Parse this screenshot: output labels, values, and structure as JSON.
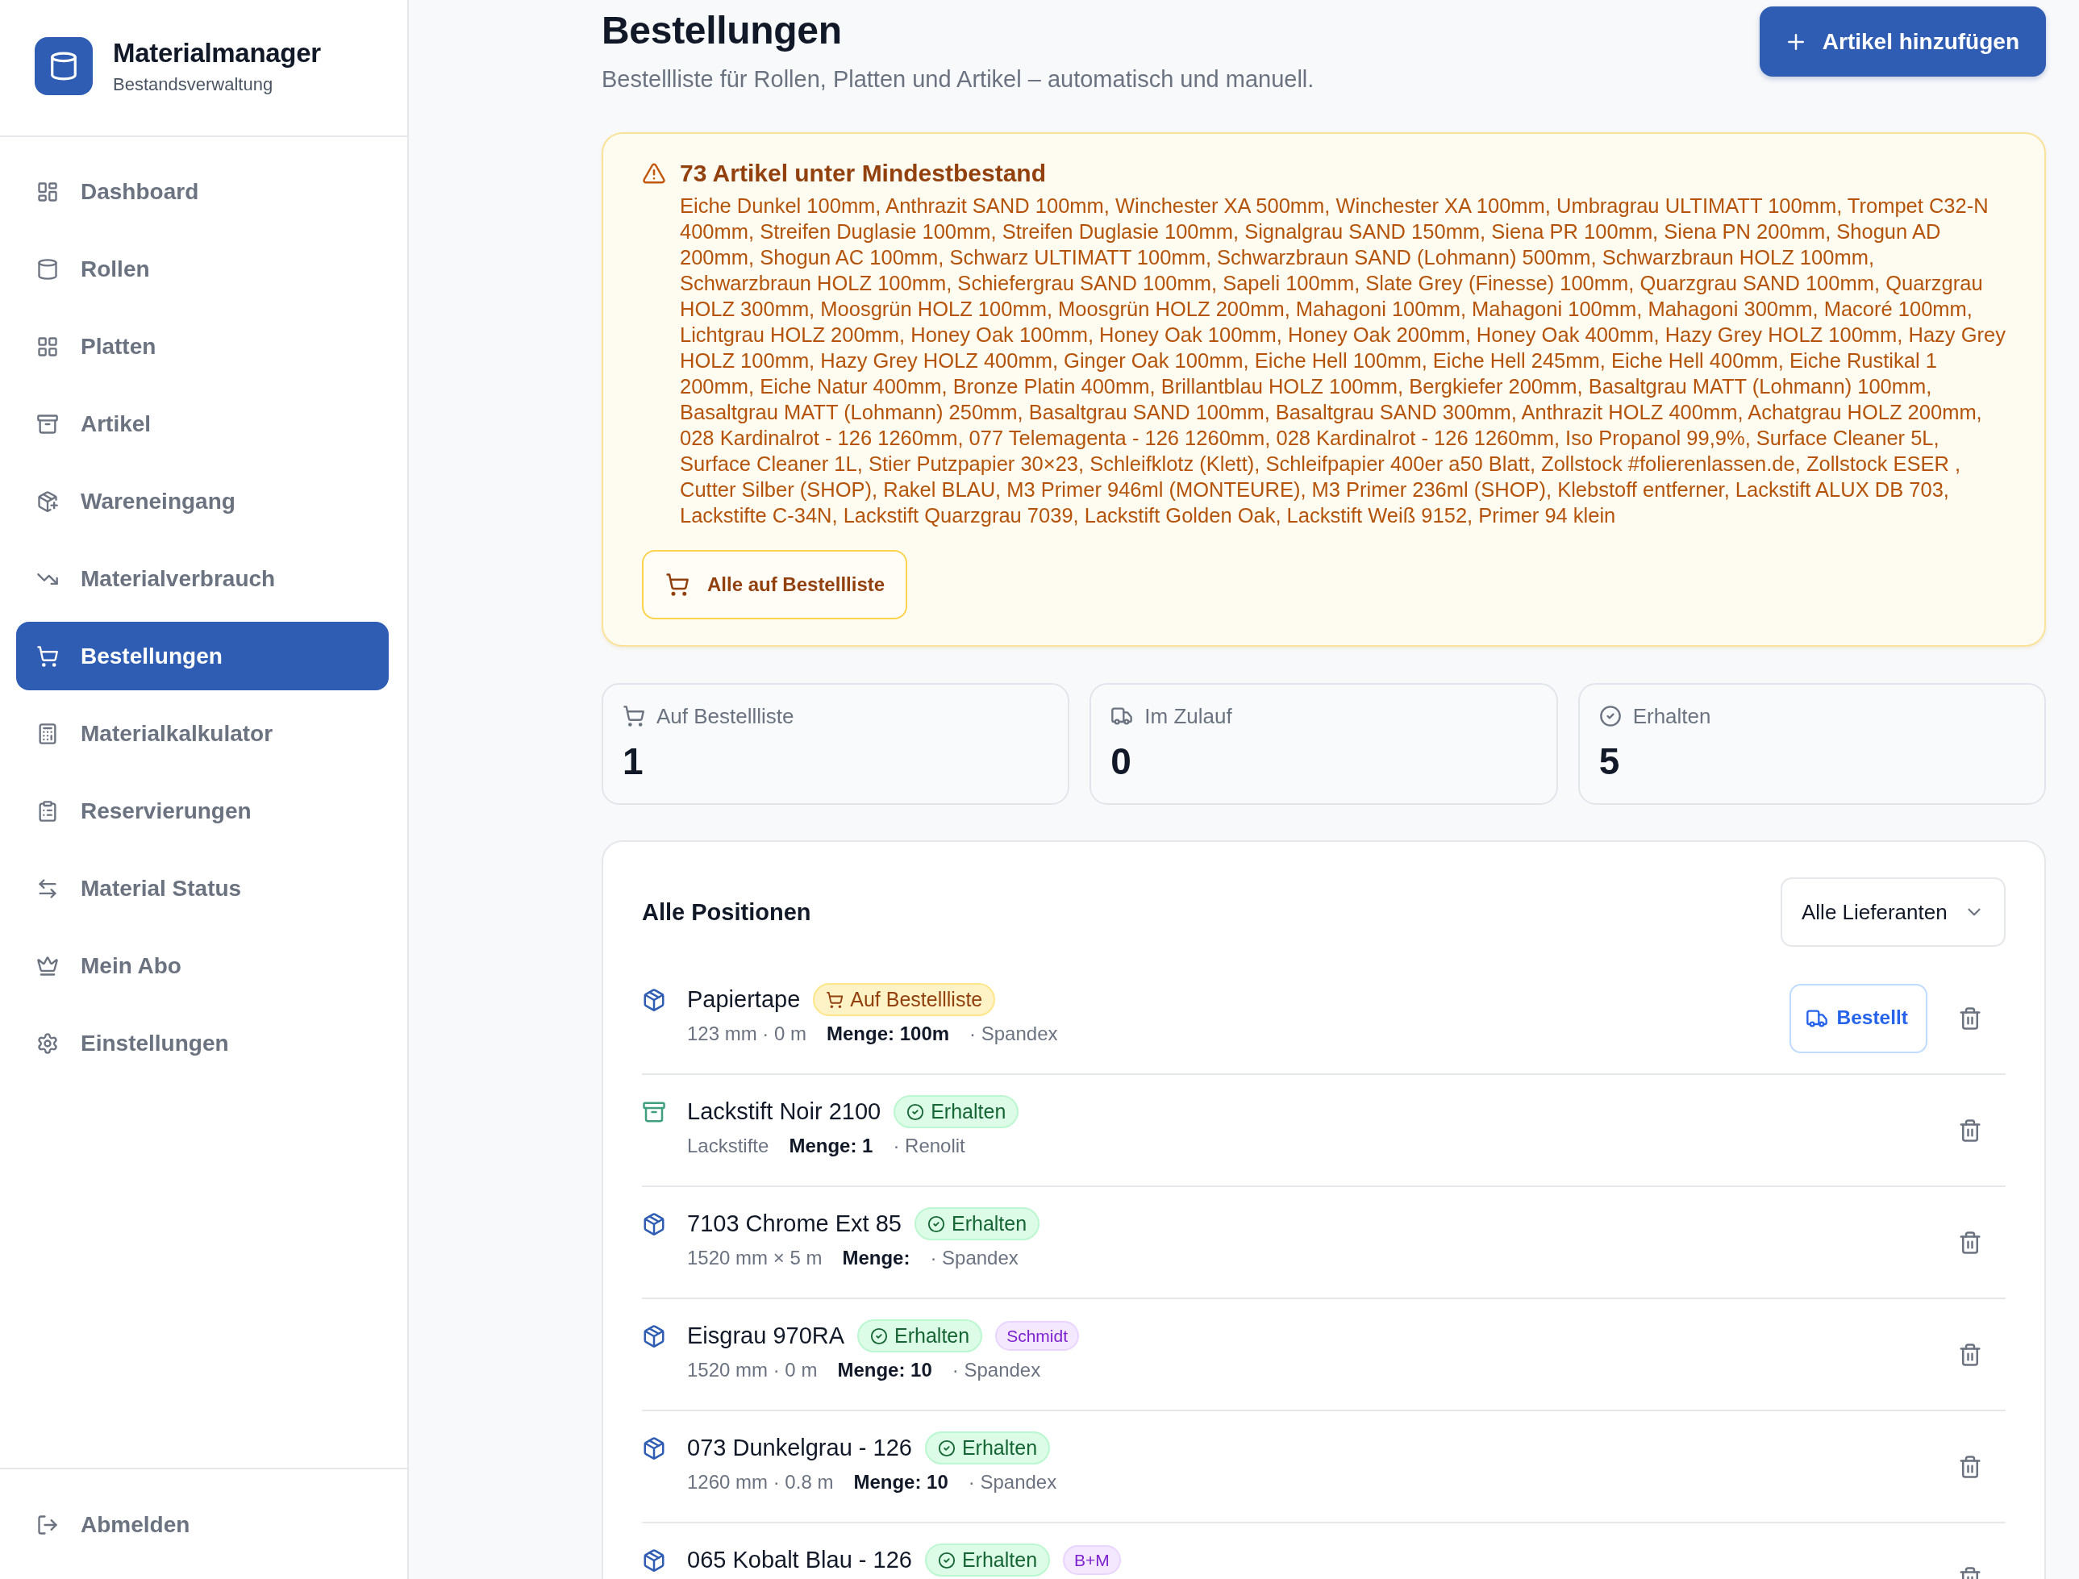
{
  "sidebar": {
    "app_name": "Materialmanager",
    "app_subtitle": "Bestandsverwaltung",
    "items": [
      {
        "label": "Dashboard",
        "selected": false
      },
      {
        "label": "Rollen",
        "selected": false
      },
      {
        "label": "Platten",
        "selected": false
      },
      {
        "label": "Artikel",
        "selected": false
      },
      {
        "label": "Wareneingang",
        "selected": false
      },
      {
        "label": "Materialverbrauch",
        "selected": false
      },
      {
        "label": "Bestellungen",
        "selected": true
      },
      {
        "label": "Materialkalkulator",
        "selected": false
      },
      {
        "label": "Reservierungen",
        "selected": false
      },
      {
        "label": "Material Status",
        "selected": false
      },
      {
        "label": "Mein Abo",
        "selected": false
      },
      {
        "label": "Einstellungen",
        "selected": false
      }
    ],
    "logout": "Abmelden"
  },
  "header": {
    "title": "Bestellungen",
    "subtitle": "Bestellliste für Rollen, Platten und Artikel – automatisch und manuell.",
    "add_button": "Artikel hinzufügen"
  },
  "alert": {
    "title": "73 Artikel unter Mindestbestand",
    "items_text": "Eiche Dunkel 100mm, Anthrazit SAND 100mm, Winchester XA 500mm, Winchester XA 100mm, Umbragrau ULTIMATT 100mm, Trompet C32-N 400mm, Streifen Duglasie 100mm, Streifen Duglasie 100mm, Signalgrau SAND 150mm, Siena PR 100mm, Siena PN 200mm, Shogun AD 200mm, Shogun AC 100mm, Schwarz ULTIMATT 100mm, Schwarzbraun SAND (Lohmann) 500mm, Schwarzbraun HOLZ 100mm, Schwarzbraun HOLZ 100mm, Schiefergrau SAND 100mm, Sapeli 100mm, Slate Grey (Finesse) 100mm, Quarzgrau SAND 100mm, Quarzgrau HOLZ 300mm, Moosgrün HOLZ 100mm, Moosgrün HOLZ 200mm, Mahagoni 100mm, Mahagoni 100mm, Mahagoni 300mm, Macoré 100mm, Lichtgrau HOLZ 200mm, Honey Oak 100mm, Honey Oak 100mm, Honey Oak 200mm, Honey Oak 400mm, Hazy Grey HOLZ 100mm, Hazy Grey HOLZ 100mm, Hazy Grey HOLZ 400mm, Ginger Oak 100mm, Eiche Hell 100mm, Eiche Hell 245mm, Eiche Hell 400mm, Eiche Rustikal 1 200mm, Eiche Natur 400mm, Bronze Platin 400mm, Brillantblau HOLZ 100mm, Bergkiefer 200mm, Basaltgrau MATT (Lohmann) 100mm, Basaltgrau MATT (Lohmann) 250mm, Basaltgrau SAND 100mm, Basaltgrau SAND 300mm, Anthrazit HOLZ 400mm, Achatgrau HOLZ 200mm, 028 Kardinalrot - 126 1260mm, 077 Telemagenta - 126 1260mm, 028 Kardinalrot - 126 1260mm, Iso Propanol 99,9%, Surface Cleaner 5L, Surface Cleaner 1L, Stier Putzpapier 30×23, Schleifklotz (Klett), Schleifpapier 400er a50 Blatt, Zollstock #folierenlassen.de, Zollstock ESER , Cutter Silber (SHOP), Rakel BLAU, M3 Primer 946ml (MONTEURE), M3 Primer 236ml (SHOP), Klebstoff entferner, Lackstift ALUX DB 703, Lackstifte C-34N, Lackstift Quarzgrau 7039, Lackstift Golden Oak, Lackstift Weiß 9152, Primer 94 klein",
    "button": "Alle auf Bestellliste"
  },
  "stats": [
    {
      "label": "Auf Bestellliste",
      "value": "1"
    },
    {
      "label": "Im Zulauf",
      "value": "0"
    },
    {
      "label": "Erhalten",
      "value": "5"
    }
  ],
  "positions": {
    "title": "Alle Positionen",
    "filter": "Alle Lieferanten",
    "rows": [
      {
        "kind": "roll",
        "name": "Papiertape",
        "status": {
          "kind": "on_list",
          "label": "Auf Bestellliste"
        },
        "detail": "123 mm · 0 m",
        "quantity": "Menge: 100m",
        "supplier": "· Spandex",
        "action": "Bestellt"
      },
      {
        "kind": "article",
        "name": "Lackstift Noir 2100",
        "status": {
          "kind": "received",
          "label": "Erhalten"
        },
        "detail": "Lackstifte",
        "quantity": "Menge: 1",
        "supplier": "· Renolit"
      },
      {
        "kind": "roll",
        "name": "7103 Chrome Ext 85",
        "status": {
          "kind": "received",
          "label": "Erhalten"
        },
        "detail": "1520 mm × 5 m",
        "quantity": "Menge:",
        "supplier": "· Spandex"
      },
      {
        "kind": "roll",
        "name": "Eisgrau 970RA",
        "status": {
          "kind": "received",
          "label": "Erhalten"
        },
        "tag": "Schmidt",
        "detail": "1520 mm · 0 m",
        "quantity": "Menge: 10",
        "supplier": "· Spandex"
      },
      {
        "kind": "roll",
        "name": "073 Dunkelgrau - 126",
        "status": {
          "kind": "received",
          "label": "Erhalten"
        },
        "detail": "1260 mm · 0.8 m",
        "quantity": "Menge: 10",
        "supplier": "· Spandex"
      },
      {
        "kind": "roll",
        "name": "065 Kobalt Blau - 126",
        "status": {
          "kind": "received",
          "label": "Erhalten"
        },
        "tag": "B+M"
      }
    ]
  }
}
